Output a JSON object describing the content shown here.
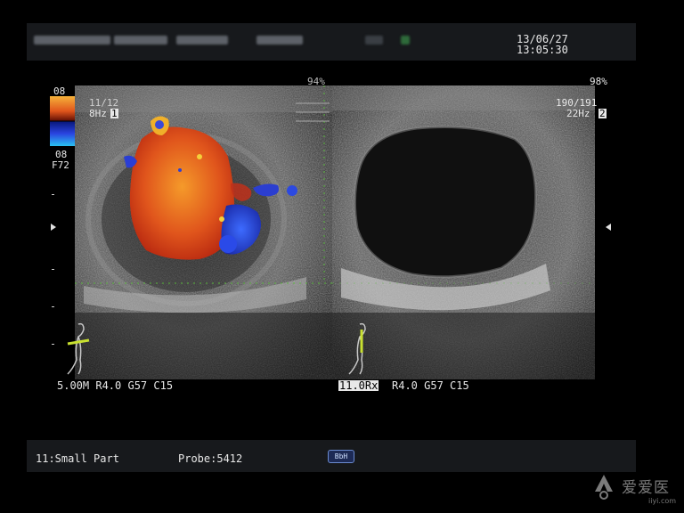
{
  "header": {
    "date": "13/06/27",
    "time": "13:05:30",
    "patient_info": "redacted"
  },
  "left_image": {
    "power": "94%",
    "color_scale_top": "08",
    "frame": "11/12",
    "frame_rate": "8Hz",
    "frame_rate_marker": "1",
    "color_scale_bottom": "08",
    "flow": "F72",
    "settings": "5.00M R4.0 G57 C15"
  },
  "right_image": {
    "power": "98%",
    "frame": "190/191",
    "frame_rate": "22Hz",
    "frame_rate_marker": "2",
    "mode": "11.0Rx",
    "settings": "R4.0 G57 C15"
  },
  "footer": {
    "preset": "11:Small Part",
    "probe": "Probe:5412",
    "badge": "BbH"
  },
  "watermark": {
    "site": "iiyi.com",
    "brand": "爱爱医"
  },
  "colors": {
    "flow_red": "#d9401a",
    "flow_orange": "#f08a22",
    "flow_blue": "#2a44e0",
    "probe_marker": "#c8e030"
  }
}
